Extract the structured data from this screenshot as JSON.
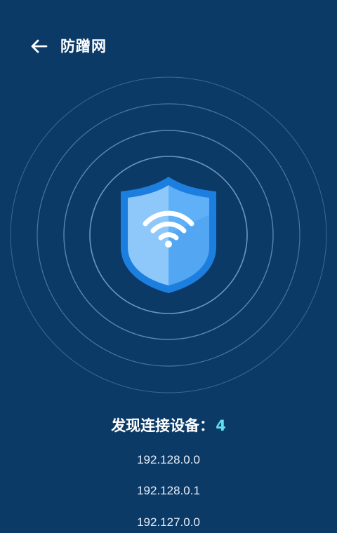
{
  "header": {
    "back_icon": "arrow-left-icon",
    "title": "防蹭网"
  },
  "radar": {
    "shield_icon": "shield-wifi-icon",
    "shield_color": "#1e88e5",
    "ring_color": "#4f7ba5"
  },
  "summary": {
    "label": "发现连接设备：",
    "count": "4",
    "count_color": "#5ee0f0"
  },
  "devices": [
    {
      "ip": "192.128.0.0"
    },
    {
      "ip": "192.128.0.1"
    },
    {
      "ip": "192.127.0.0"
    }
  ],
  "colors": {
    "background": "#0c3a67"
  }
}
